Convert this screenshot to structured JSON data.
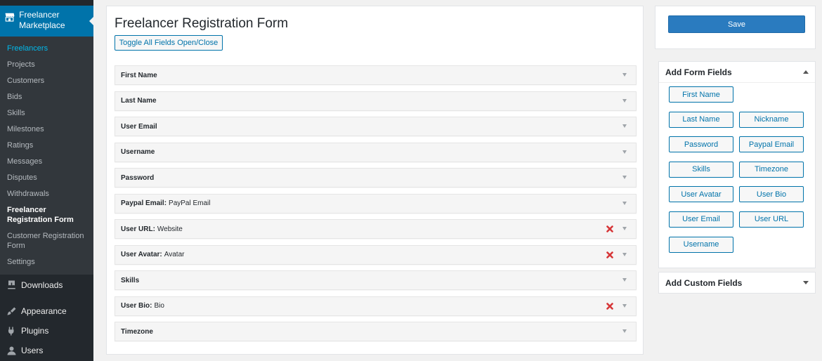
{
  "sidebar": {
    "active_menu": {
      "label": "Freelancer Marketplace",
      "icon": "storefront-icon"
    },
    "submenu": [
      {
        "label": "Freelancers",
        "state": "current"
      },
      {
        "label": "Projects",
        "state": ""
      },
      {
        "label": "Customers",
        "state": ""
      },
      {
        "label": "Bids",
        "state": ""
      },
      {
        "label": "Skills",
        "state": ""
      },
      {
        "label": "Milestones",
        "state": ""
      },
      {
        "label": "Ratings",
        "state": ""
      },
      {
        "label": "Messages",
        "state": ""
      },
      {
        "label": "Disputes",
        "state": ""
      },
      {
        "label": "Withdrawals",
        "state": ""
      },
      {
        "label": "Freelancer Registration Form",
        "state": "bold"
      },
      {
        "label": "Customer Registration Form",
        "state": ""
      },
      {
        "label": "Settings",
        "state": ""
      }
    ],
    "menu": [
      {
        "label": "Downloads",
        "icon": "download-icon"
      },
      {
        "label": "Appearance",
        "icon": "paintbrush-icon"
      },
      {
        "label": "Plugins",
        "icon": "plug-icon"
      },
      {
        "label": "Users",
        "icon": "user-icon"
      }
    ]
  },
  "main": {
    "title": "Freelancer Registration Form",
    "toggle_label": "Toggle All Fields Open/Close",
    "fields": [
      {
        "name": "First Name",
        "sub": "",
        "removable": false
      },
      {
        "name": "Last Name",
        "sub": "",
        "removable": false
      },
      {
        "name": "User Email",
        "sub": "",
        "removable": false
      },
      {
        "name": "Username",
        "sub": "",
        "removable": false
      },
      {
        "name": "Password",
        "sub": "",
        "removable": false
      },
      {
        "name": "Paypal Email:",
        "sub": "PayPal Email",
        "removable": false
      },
      {
        "name": "User URL:",
        "sub": "Website",
        "removable": true
      },
      {
        "name": "User Avatar:",
        "sub": "Avatar",
        "removable": true
      },
      {
        "name": "Skills",
        "sub": "",
        "removable": false
      },
      {
        "name": "User Bio:",
        "sub": "Bio",
        "removable": true
      },
      {
        "name": "Timezone",
        "sub": "",
        "removable": false
      }
    ]
  },
  "right": {
    "save_label": "Save",
    "add_fields_title": "Add Form Fields",
    "add_fields_buttons": [
      [
        "First Name"
      ],
      [
        "Last Name",
        "Nickname"
      ],
      [
        "Password",
        "Paypal Email"
      ],
      [
        "Skills",
        "Timezone"
      ],
      [
        "User Avatar",
        "User Bio"
      ],
      [
        "User Email",
        "User URL"
      ],
      [
        "Username"
      ]
    ],
    "custom_fields_title": "Add Custom Fields"
  },
  "colors": {
    "admin_bar": "#23282d",
    "active_menu": "#0073aa",
    "submenu_bg": "#32373c",
    "current_link": "#00b9eb",
    "button_blue": "#2a7bbf",
    "remove_red": "#d63638"
  }
}
